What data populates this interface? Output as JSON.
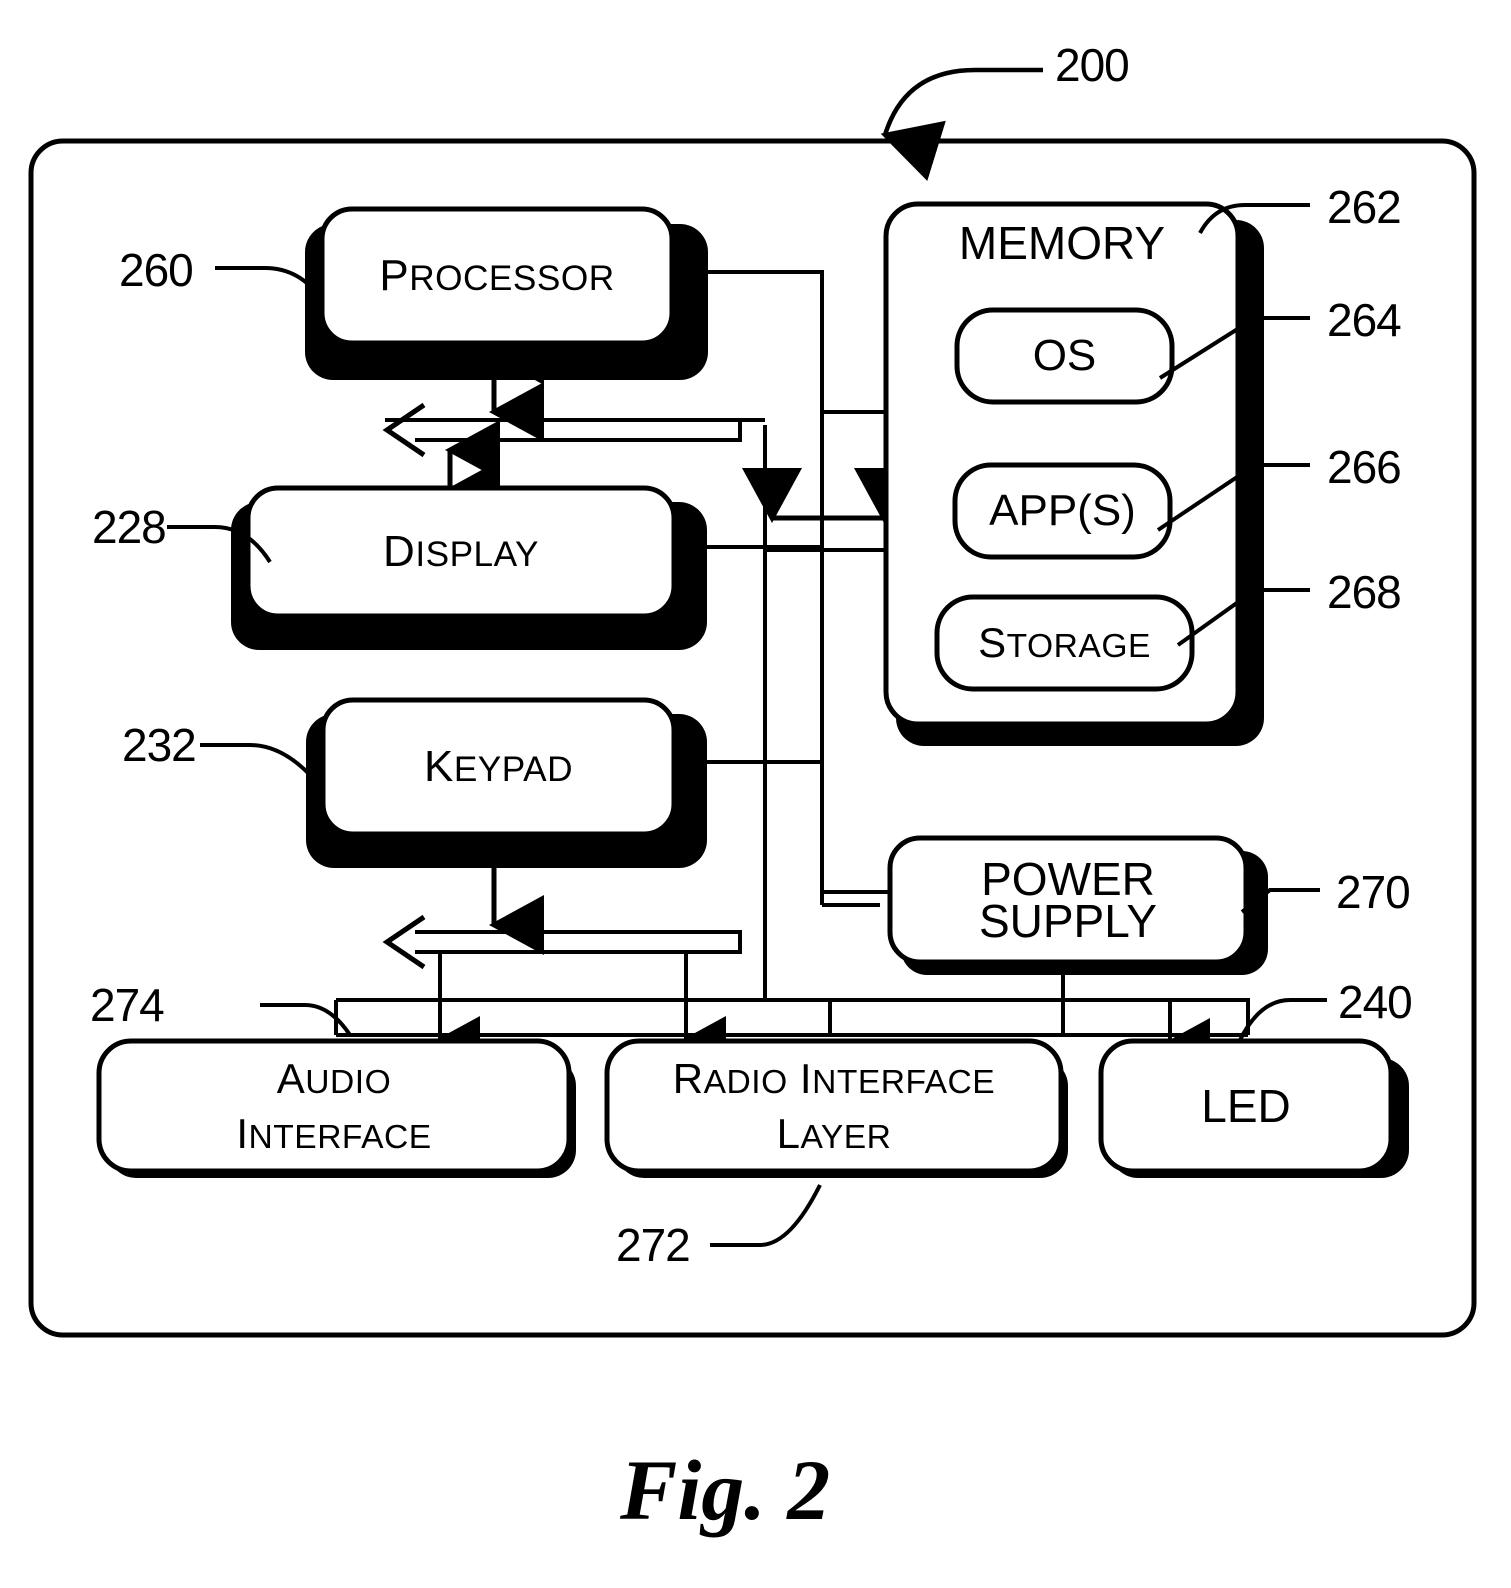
{
  "figure": {
    "caption": "Fig. 2",
    "device_ref": "200"
  },
  "blocks": [
    {
      "id": "processor",
      "label": "Processor",
      "ref": "260",
      "style": "smallcaps"
    },
    {
      "id": "display",
      "label": "Display",
      "ref": "228",
      "style": "smallcaps"
    },
    {
      "id": "keypad",
      "label": "Keypad",
      "ref": "232",
      "style": "smallcaps"
    },
    {
      "id": "memory",
      "label": "MEMORY",
      "ref": "262",
      "style": "plain"
    },
    {
      "id": "os",
      "label": "OS",
      "ref": "264",
      "style": "plain"
    },
    {
      "id": "apps",
      "label": "APP(S)",
      "ref": "266",
      "style": "plain"
    },
    {
      "id": "storage",
      "label": "Storage",
      "ref": "268",
      "style": "smallcaps"
    },
    {
      "id": "power-supply",
      "label_line1": "POWER",
      "label_line2": "SUPPLY",
      "ref": "270",
      "style": "plain"
    },
    {
      "id": "audio-interface",
      "label_line1": "Audio",
      "label_line2": "Interface",
      "ref": "274",
      "style": "smallcaps"
    },
    {
      "id": "radio-interface-layer",
      "label_line1": "Radio Interface",
      "label_line2": "Layer",
      "ref": "272",
      "style": "smallcaps"
    },
    {
      "id": "led",
      "label": "LED",
      "ref": "240",
      "style": "plain"
    }
  ],
  "labels": {
    "processor": "Processor",
    "display": "Display",
    "keypad": "Keypad",
    "memory": "MEMORY",
    "os": "OS",
    "apps": "APP(S)",
    "storage": "Storage",
    "power_line1": "POWER",
    "power_line2": "SUPPLY",
    "audio_line1": "Audio",
    "audio_line2": "Interface",
    "radio_line1": "Radio Interface",
    "radio_line2": "Layer",
    "led": "LED"
  },
  "refs": {
    "device": "200",
    "processor": "260",
    "display": "228",
    "keypad": "232",
    "memory": "262",
    "os": "264",
    "apps": "266",
    "storage": "268",
    "power_supply": "270",
    "audio_interface": "274",
    "radio_interface_layer": "272",
    "led": "240"
  },
  "colors": {
    "ink": "#000000",
    "paper": "#ffffff"
  }
}
